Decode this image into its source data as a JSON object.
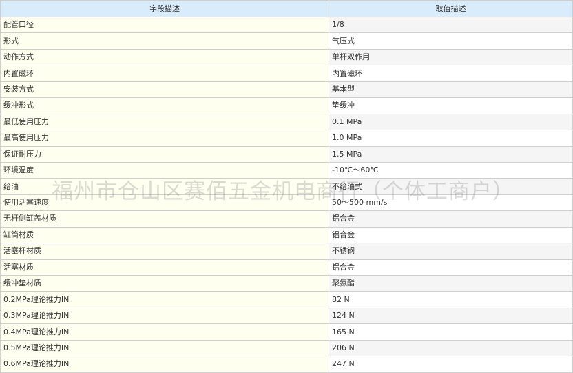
{
  "header": {
    "field": "字段描述",
    "value": "取值描述"
  },
  "rows": [
    {
      "k": "配管口径",
      "v": "1/8"
    },
    {
      "k": "形式",
      "v": "气压式"
    },
    {
      "k": "动作方式",
      "v": "单杆双作用"
    },
    {
      "k": "内置磁环",
      "v": "内置磁环"
    },
    {
      "k": "安装方式",
      "v": "基本型"
    },
    {
      "k": "缓冲形式",
      "v": "垫缓冲"
    },
    {
      "k": "最低使用压力",
      "v": "0.1 MPa"
    },
    {
      "k": "最高使用压力",
      "v": "1.0 MPa"
    },
    {
      "k": "保证耐压力",
      "v": "1.5 MPa"
    },
    {
      "k": "环境温度",
      "v": "-10℃～60℃"
    },
    {
      "k": "给油",
      "v": "不给油式"
    },
    {
      "k": "使用活塞速度",
      "v": "50～500 mm/s"
    },
    {
      "k": "无杆侧缸盖材质",
      "v": "铝合金"
    },
    {
      "k": "缸筒材质",
      "v": "铝合金"
    },
    {
      "k": "活塞杆材质",
      "v": "不锈钢"
    },
    {
      "k": "活塞材质",
      "v": "铝合金"
    },
    {
      "k": "缓冲垫材质",
      "v": "聚氨酯"
    },
    {
      "k": "0.2MPa理论推力IN",
      "v": "82 N"
    },
    {
      "k": "0.3MPa理论推力IN",
      "v": "124 N"
    },
    {
      "k": "0.4MPa理论推力IN",
      "v": "165 N"
    },
    {
      "k": "0.5MPa理论推力IN",
      "v": "206 N"
    },
    {
      "k": "0.6MPa理论推力IN",
      "v": "247 N"
    }
  ],
  "watermark": "福州市仓山区赛佰五金机电商行（个体工商户）"
}
